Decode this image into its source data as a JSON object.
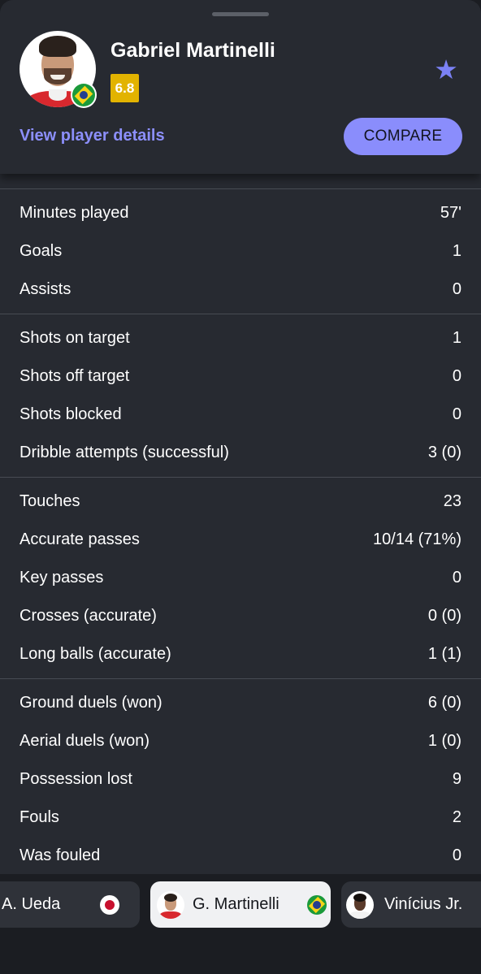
{
  "header": {
    "player_name": "Gabriel Martinelli",
    "rating": "6.8",
    "rating_color": "#e2b300",
    "view_details_label": "View player details",
    "compare_label": "COMPARE",
    "accent_color": "#8a8dfc",
    "favorite_icon": "star-icon",
    "nationality_icon": "brazil-flag-icon"
  },
  "stats": {
    "group1": [
      {
        "label": "Minutes played",
        "value": "57'"
      },
      {
        "label": "Goals",
        "value": "1"
      },
      {
        "label": "Assists",
        "value": "0"
      }
    ],
    "group2": [
      {
        "label": "Shots on target",
        "value": "1"
      },
      {
        "label": "Shots off target",
        "value": "0"
      },
      {
        "label": "Shots blocked",
        "value": "0"
      },
      {
        "label": "Dribble attempts (successful)",
        "value": "3 (0)"
      }
    ],
    "group3": [
      {
        "label": "Touches",
        "value": "23"
      },
      {
        "label": "Accurate passes",
        "value": "10/14 (71%)"
      },
      {
        "label": "Key passes",
        "value": "0"
      },
      {
        "label": "Crosses (accurate)",
        "value": "0 (0)"
      },
      {
        "label": "Long balls (accurate)",
        "value": "1 (1)"
      }
    ],
    "group4": [
      {
        "label": "Ground duels (won)",
        "value": "6 (0)"
      },
      {
        "label": "Aerial duels (won)",
        "value": "1 (0)"
      },
      {
        "label": "Possession lost",
        "value": "9"
      },
      {
        "label": "Fouls",
        "value": "2"
      },
      {
        "label": "Was fouled",
        "value": "0"
      }
    ]
  },
  "player_switcher": {
    "prev": {
      "name": "A. Ueda",
      "flag_icon": "japan-flag-icon"
    },
    "current": {
      "name": "G. Martinelli",
      "flag_icon": "brazil-flag-icon"
    },
    "next": {
      "name": "Vinícius Jr."
    }
  }
}
